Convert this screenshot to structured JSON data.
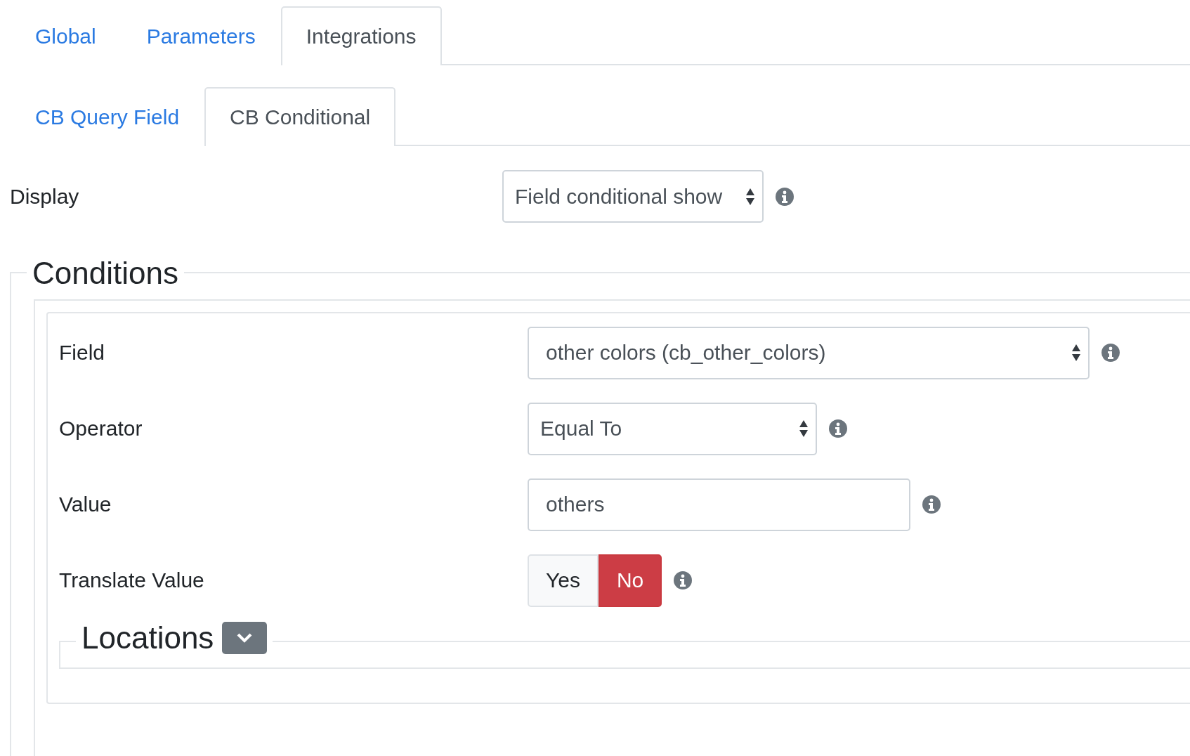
{
  "tabs": [
    {
      "label": "Global",
      "selected": false
    },
    {
      "label": "Parameters",
      "selected": false
    },
    {
      "label": "Integrations",
      "selected": true
    }
  ],
  "subtabs": [
    {
      "label": "CB Query Field",
      "selected": false
    },
    {
      "label": "CB Conditional",
      "selected": true
    }
  ],
  "display": {
    "label": "Display",
    "value": "Field conditional show"
  },
  "conditions": {
    "legend": "Conditions",
    "rows": [
      {
        "kind": "select",
        "label": "Field",
        "value": "other colors (cb_other_colors)"
      },
      {
        "kind": "select",
        "label": "Operator",
        "value": "Equal To"
      },
      {
        "kind": "input",
        "label": "Value",
        "value": "others"
      },
      {
        "kind": "toggle",
        "label": "Translate Value",
        "options": [
          {
            "label": "Yes",
            "selected": false
          },
          {
            "label": "No",
            "selected": true
          }
        ]
      }
    ]
  },
  "locations": {
    "legend": "Locations",
    "expanded": false
  }
}
